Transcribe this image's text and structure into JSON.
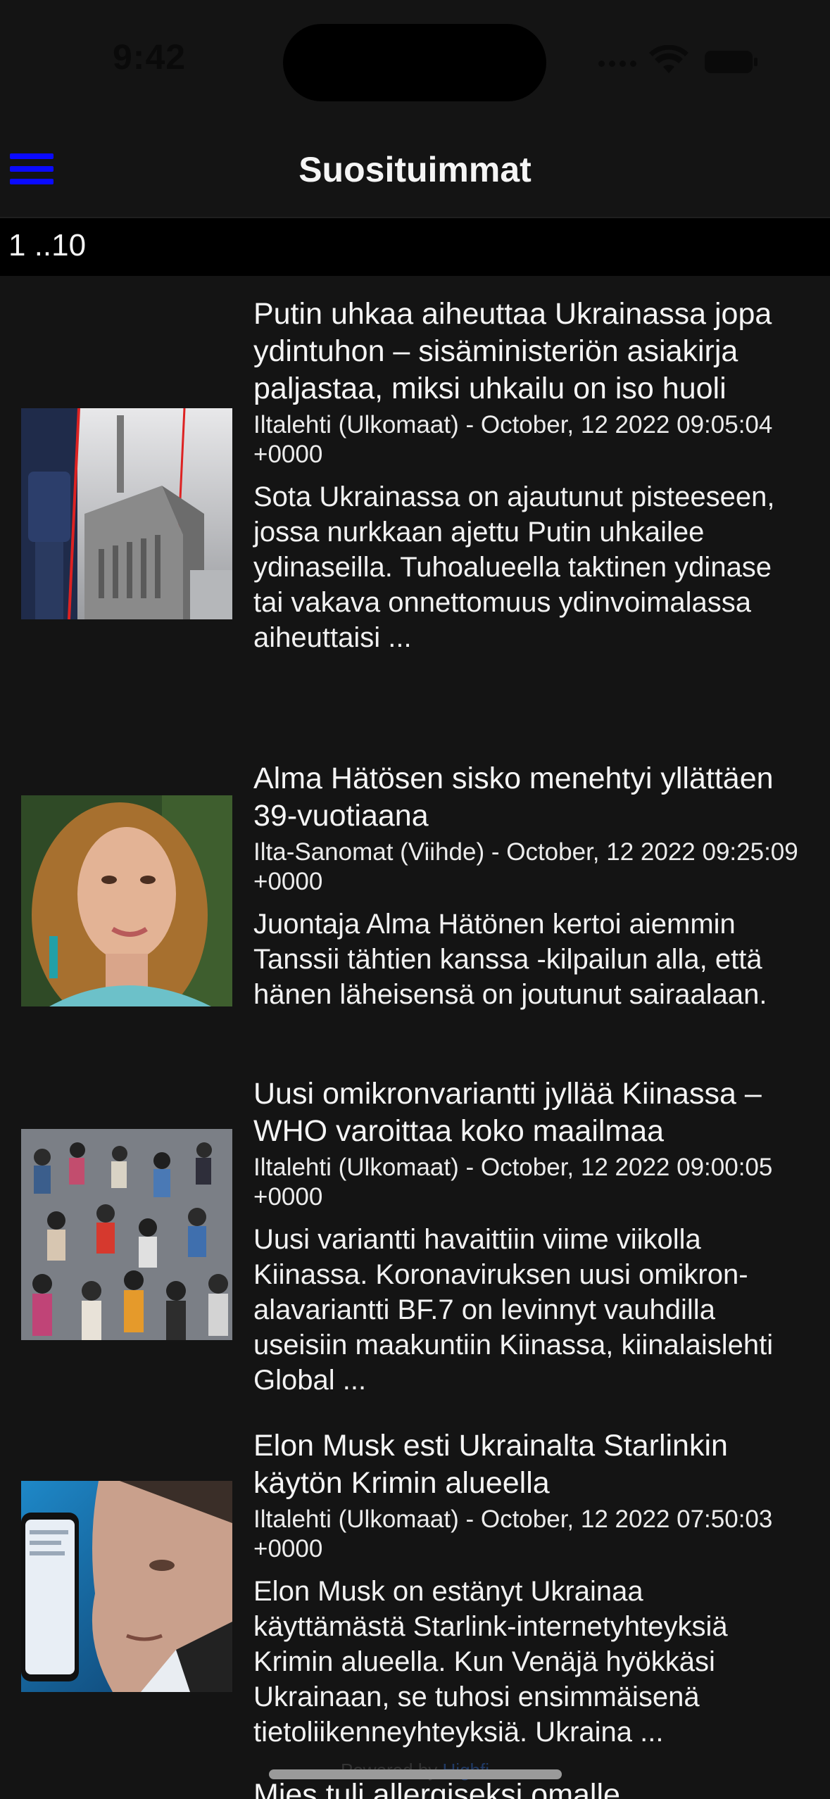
{
  "status_bar": {
    "time": "9:42"
  },
  "nav": {
    "title": "Suosituimmat",
    "menu_icon": "hamburger-menu-icon",
    "accent_color": "#0a0aff"
  },
  "range": {
    "label": "1 ..10"
  },
  "articles": [
    {
      "title": "Putin uhkaa aiheuttaa Ukrainassa jopa ydintuhon – sisäministeriön asiakirja paljastaa, miksi uhkailu on iso huoli",
      "meta": "Iltalehti (Ulkomaat) - October, 12 2022 09:05:04 +0000",
      "summary": "Sota Ukrainassa on ajautunut pisteeseen, jossa nurkkaan ajettu Putin uhkailee ydinaseilla. Tuhoalueella taktinen ydinase tai vakava onnettomuus ydinvoimalassa aiheuttaisi ..."
    },
    {
      "title": "Alma Hätösen sisko menehtyi yllättäen 39-vuotiaana",
      "meta": "Ilta-Sanomat (Viihde) - October, 12 2022 09:25:09 +0000",
      "summary": "Juontaja Alma Hätönen kertoi aiemmin Tanssii tähtien kanssa -kilpailun alla, että hänen läheisensä on joutunut sairaalaan."
    },
    {
      "title": "Uusi omikronvariantti jyllää Kiinassa – WHO varoittaa koko maailmaa",
      "meta": "Iltalehti (Ulkomaat) - October, 12 2022 09:00:05 +0000",
      "summary": "Uusi variantti havaittiin viime viikolla Kiinassa. Koronaviruksen uusi omikron-alavariantti BF.7 on levinnyt vauhdilla useisiin maakuntiin Kiinassa, kiinalaislehti Global ..."
    },
    {
      "title": "Elon Musk esti Ukrainalta Starlinkin käytön Krimin alueella",
      "meta": "Iltalehti (Ulkomaat) - October, 12 2022 07:50:03 +0000",
      "summary": "Elon Musk on estänyt Ukrainaa käyttämästä Starlink-internetyhteyksiä Krimin alueella. Kun Venäjä hyökkäsi Ukrainaan, se tuhosi ensimmäisenä tietoliikenneyhteyksiä. Ukraina ..."
    }
  ],
  "footer": {
    "powered_prefix": "Powered by",
    "powered_link": "Highfi",
    "next_title_partial": "Mies tuli allergiseksi omalle"
  }
}
